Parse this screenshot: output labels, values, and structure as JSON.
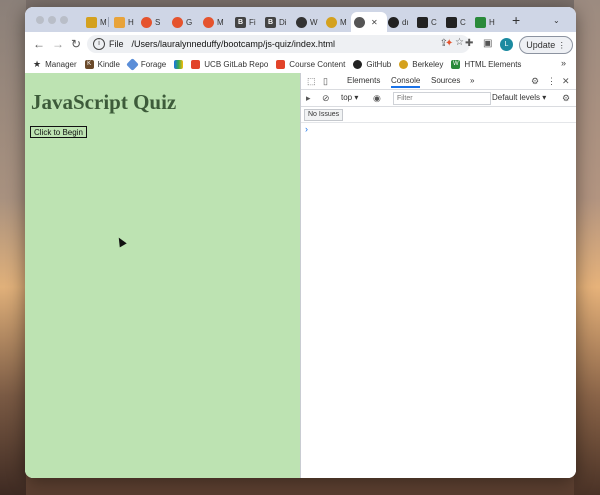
{
  "browser": {
    "tabs": [
      {
        "label": "M",
        "icon": "mail-icon",
        "color": "#d4a11e"
      },
      {
        "label": "H",
        "icon": "tab-icon",
        "color": "#e8a33a"
      },
      {
        "label": "S",
        "icon": "tab-icon",
        "color": "#e5532d"
      },
      {
        "label": "G",
        "icon": "tab-icon",
        "color": "#e5532d"
      },
      {
        "label": "M",
        "icon": "tab-icon",
        "color": "#e5532d"
      },
      {
        "label": "Fi",
        "icon": "bootstrap-icon",
        "color": "#444"
      },
      {
        "label": "Di",
        "icon": "bootstrap-icon",
        "color": "#444"
      },
      {
        "label": "W",
        "icon": "tab-icon",
        "color": "#333"
      },
      {
        "label": "M",
        "icon": "tab-icon",
        "color": "#d4a11e"
      },
      {
        "label": "",
        "icon": "globe-icon",
        "color": "#555"
      },
      {
        "label": "dı",
        "icon": "github-icon",
        "color": "#222"
      },
      {
        "label": "C",
        "icon": "tab-icon",
        "color": "#222"
      },
      {
        "label": "C",
        "icon": "tab-icon",
        "color": "#222"
      },
      {
        "label": "H",
        "icon": "tab-icon",
        "color": "#2a8a3a"
      }
    ],
    "new_tab_label": "+",
    "omnibox": {
      "scheme_label": "File",
      "url": "/Users/lauralynneduffy/bootcamp/js-quiz/index.html"
    },
    "avatar_letter": "L",
    "update_label": "Update",
    "bookmarks": [
      {
        "label": "Manager",
        "icon": "star-icon",
        "color": "#333"
      },
      {
        "label": "Kindle",
        "icon": "kindle-icon",
        "color": "#6b4a2a"
      },
      {
        "label": "Forage",
        "icon": "forage-icon",
        "color": "#5b8ed8"
      },
      {
        "label": "",
        "icon": "drive-icon",
        "color": "#1a73e8"
      },
      {
        "label": "UCB GitLab Repo",
        "icon": "gitlab-icon",
        "color": "#e24329"
      },
      {
        "label": "Course Content",
        "icon": "gitlab-icon",
        "color": "#e24329"
      },
      {
        "label": "GitHub",
        "icon": "github-icon",
        "color": "#222"
      },
      {
        "label": "Berkeley",
        "icon": "berkeley-icon",
        "color": "#d4a11e"
      },
      {
        "label": "HTML Elements",
        "icon": "w3-icon",
        "color": "#2a8a3a"
      }
    ],
    "bookmarks_more": "»"
  },
  "page": {
    "heading": "JavaScript Quiz",
    "button_label": "Click to Begin",
    "background": "#bde3b2"
  },
  "devtools": {
    "tabs": [
      "Elements",
      "Console",
      "Sources"
    ],
    "active_tab": "Console",
    "more_tabs": "»",
    "context": "top",
    "filter_placeholder": "Filter",
    "levels_label": "Default levels",
    "issues_label": "No Issues",
    "prompt": "›"
  }
}
